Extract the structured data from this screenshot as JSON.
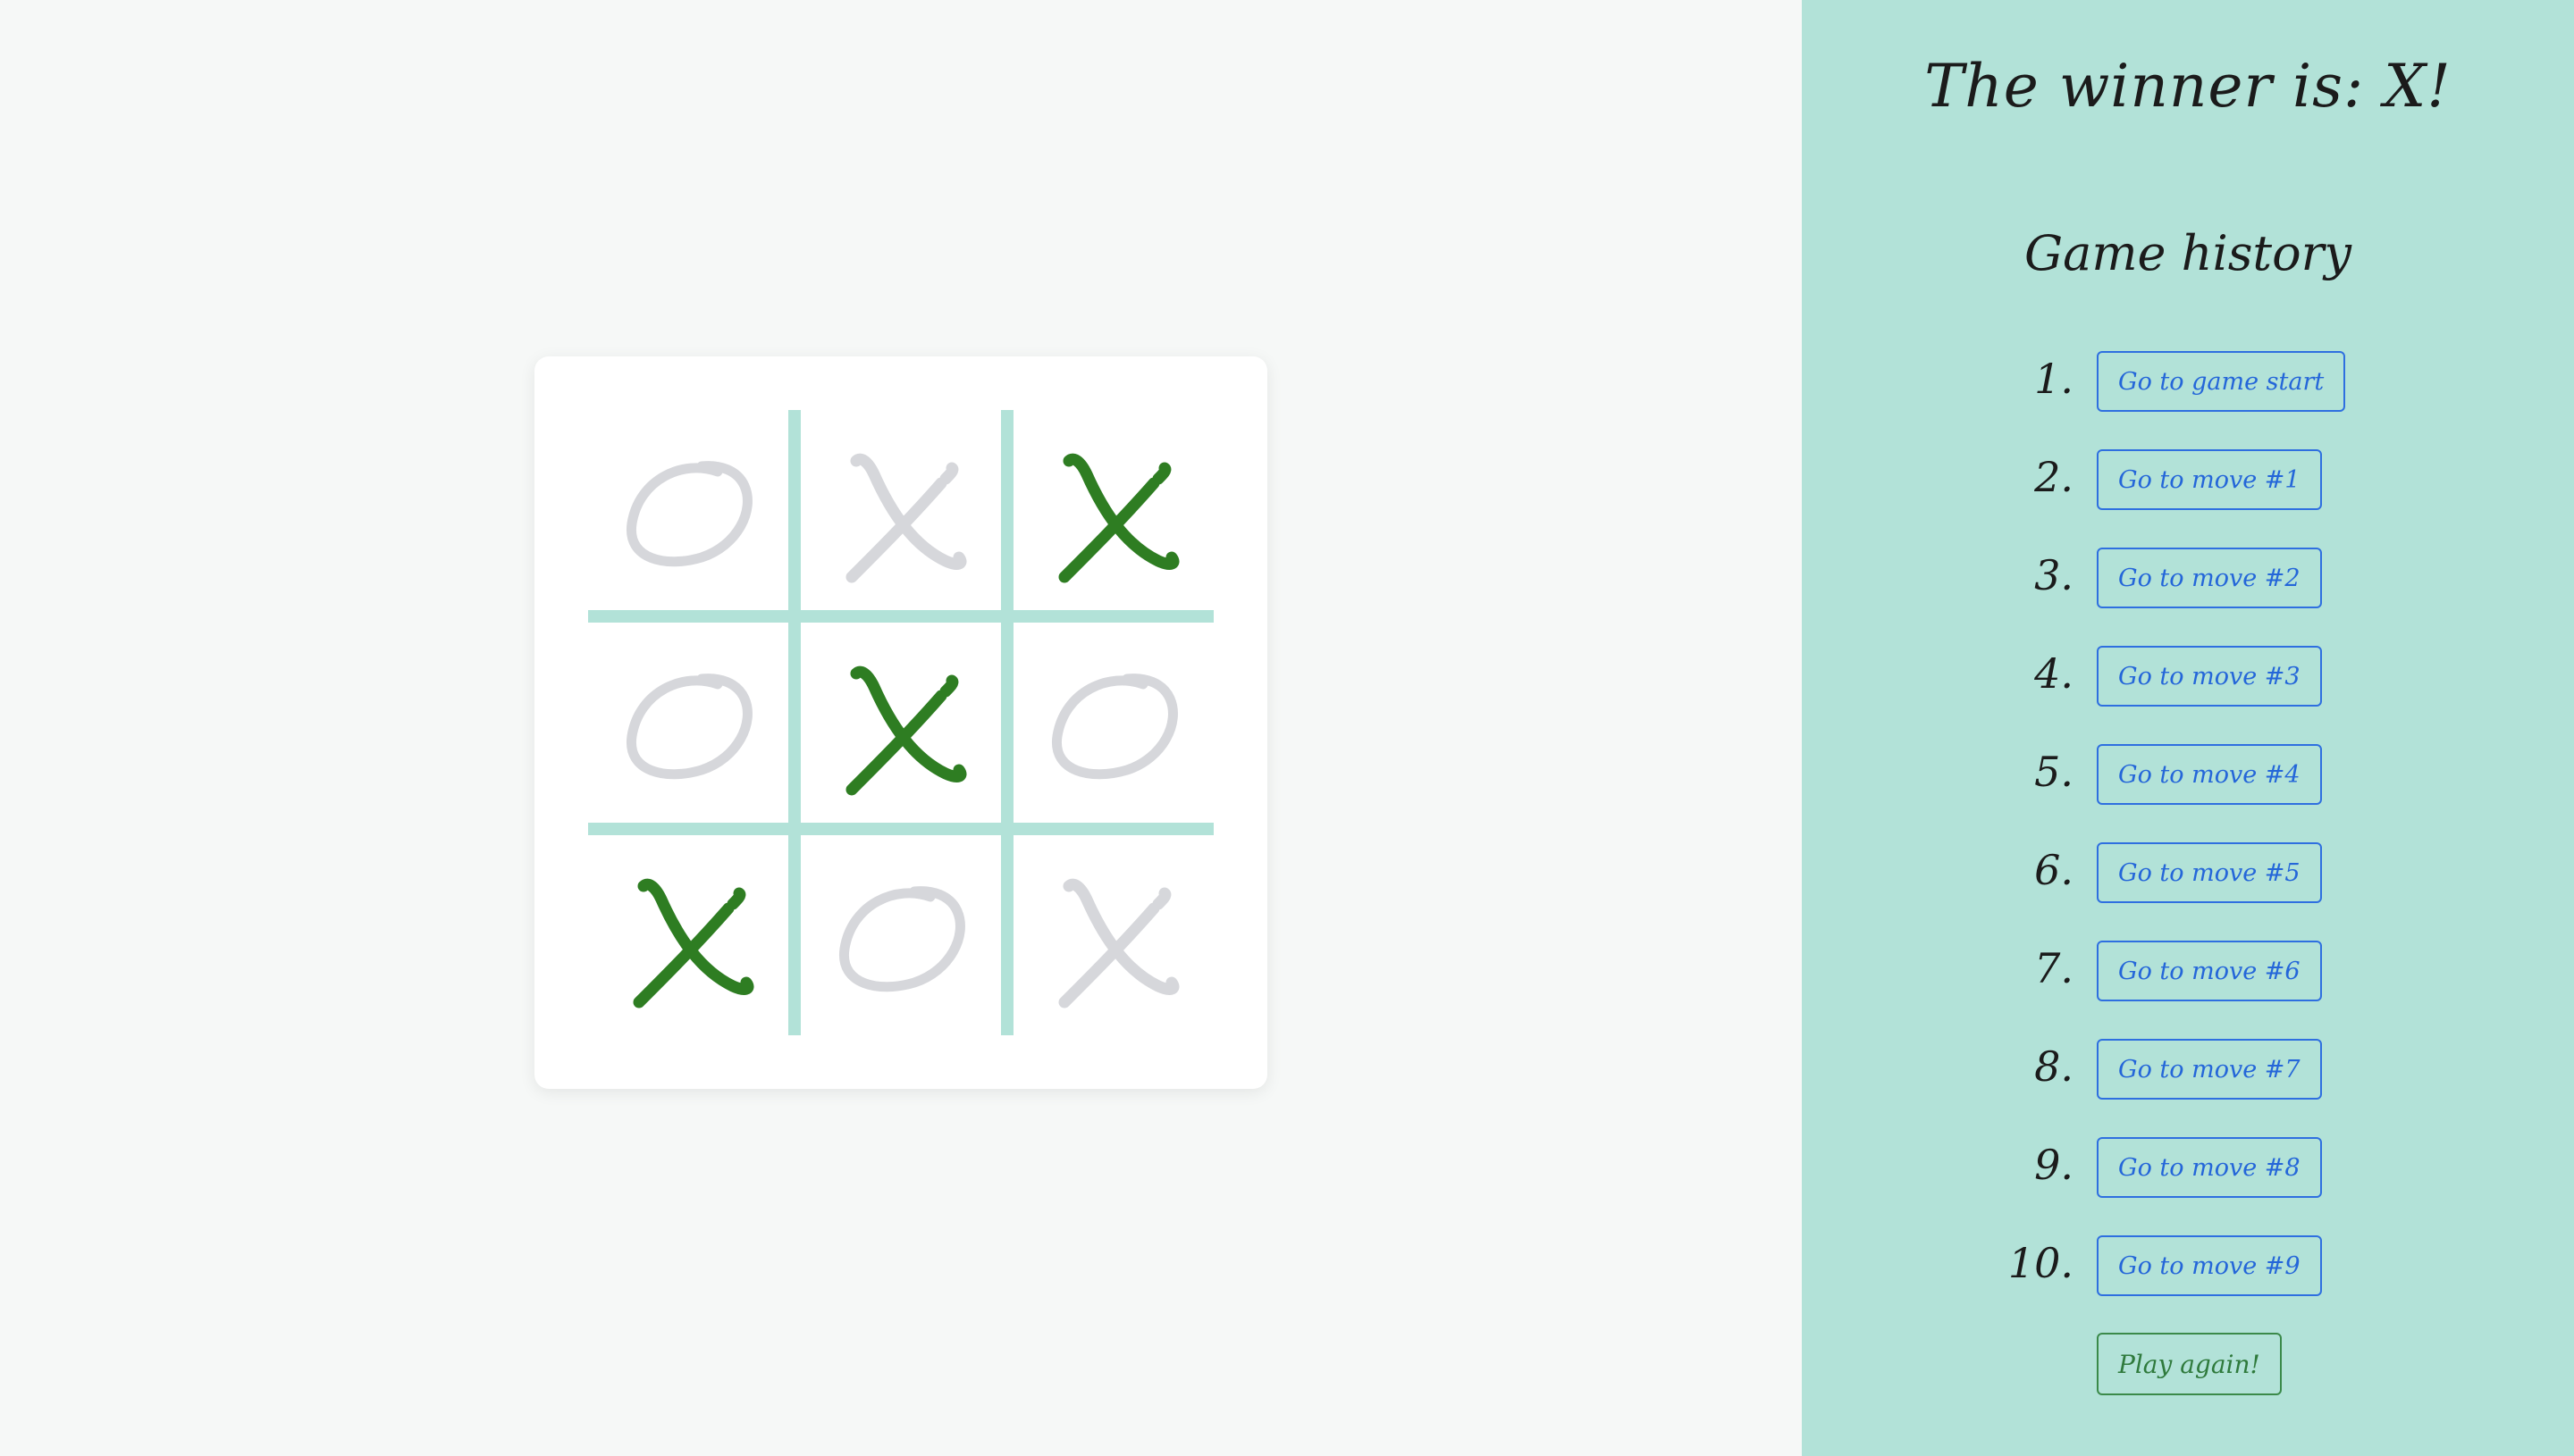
{
  "status": {
    "winner_text": "The winner is: X!"
  },
  "history": {
    "title": "Game history",
    "moves": [
      {
        "number": "1.",
        "label": "Go to game start"
      },
      {
        "number": "2.",
        "label": "Go to move #1"
      },
      {
        "number": "3.",
        "label": "Go to move #2"
      },
      {
        "number": "4.",
        "label": "Go to move #3"
      },
      {
        "number": "5.",
        "label": "Go to move #4"
      },
      {
        "number": "6.",
        "label": "Go to move #5"
      },
      {
        "number": "7.",
        "label": "Go to move #6"
      },
      {
        "number": "8.",
        "label": "Go to move #7"
      },
      {
        "number": "9.",
        "label": "Go to move #8"
      },
      {
        "number": "10.",
        "label": "Go to move #9"
      }
    ],
    "play_again_label": "Play again!"
  },
  "board": {
    "cells": [
      {
        "mark": "O",
        "winning": false
      },
      {
        "mark": "X",
        "winning": false
      },
      {
        "mark": "X",
        "winning": true
      },
      {
        "mark": "O",
        "winning": false
      },
      {
        "mark": "X",
        "winning": true
      },
      {
        "mark": "O",
        "winning": false
      },
      {
        "mark": "X",
        "winning": true
      },
      {
        "mark": "O",
        "winning": false
      },
      {
        "mark": "X",
        "winning": false
      }
    ]
  },
  "colors": {
    "winning_mark": "#2e7d22",
    "normal_mark": "#d6d7db",
    "grid_line": "#b2e2d8",
    "sidebar_bg": "#b2e2d8",
    "history_button": "#2466d9",
    "play_again": "#2f7a3c"
  },
  "icons": {
    "x_mark": "x-mark-icon",
    "o_mark": "o-mark-icon"
  }
}
